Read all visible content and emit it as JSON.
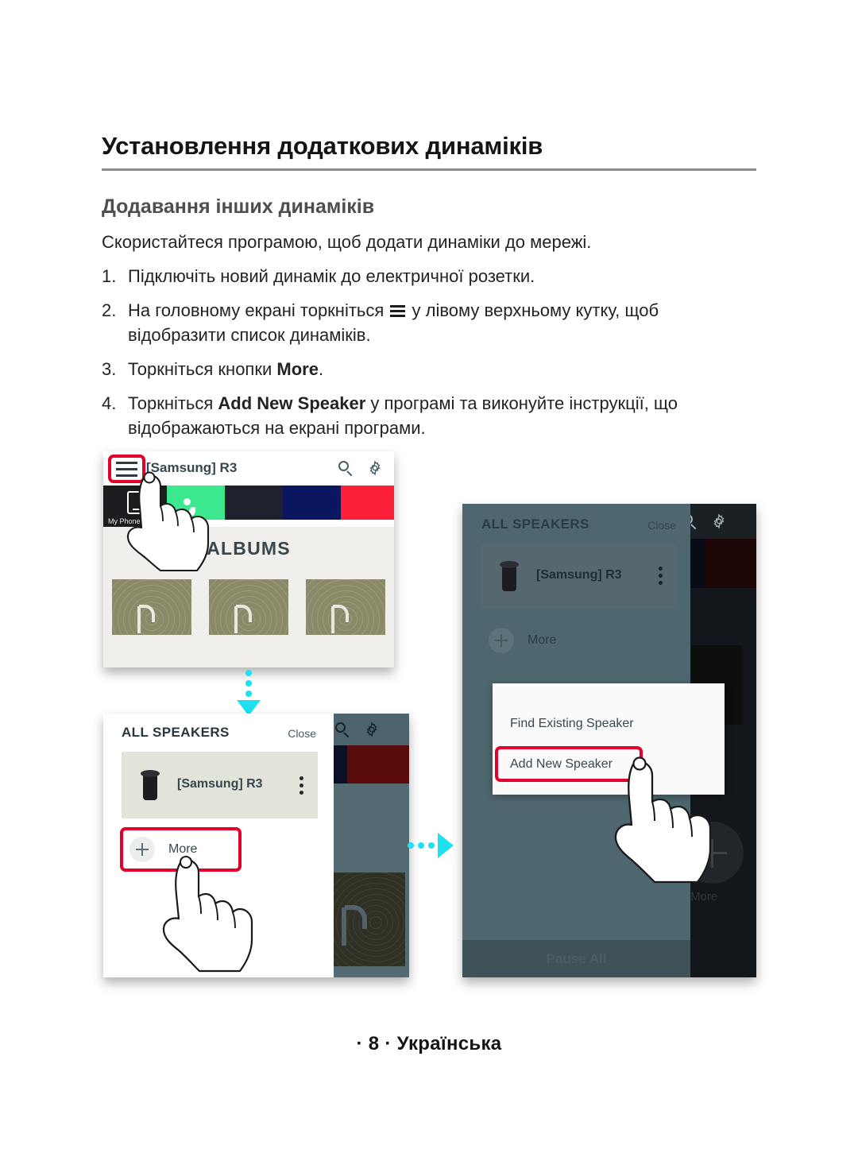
{
  "page": {
    "heading": "Установлення додаткових динаміків",
    "subheading": "Додавання інших динаміків",
    "intro": "Скористайтеся програмою, щоб додати динаміки до мережі.",
    "footer": "· 8 · Українська"
  },
  "steps": [
    {
      "num": "1.",
      "pre": "Підключіть новий динамік до електричної розетки.",
      "icon": "",
      "bold": "",
      "post": ""
    },
    {
      "num": "2.",
      "pre": "На головному екрані торкніться ",
      "icon": "hamburger-icon",
      "bold": "",
      "post": " у лівому верхньому кутку, щоб відобразити список динаміків."
    },
    {
      "num": "3.",
      "pre": "Торкніться кнопки ",
      "icon": "",
      "bold": "More",
      "post": "."
    },
    {
      "num": "4.",
      "pre": "Торкніться ",
      "icon": "",
      "bold": "Add New Speaker",
      "post": " у програмі та виконуйте інструкції, що відображаються на екрані програми."
    }
  ],
  "shot1": {
    "title": "[Samsung] R3",
    "my_phone_label": "My Phone",
    "albums_label": "ALBUMS",
    "search_icon": "search-icon",
    "settings_icon": "gear-icon",
    "menu_icon": "hamburger-icon",
    "strip_colors": [
      "#1b1c20",
      "#3ce88f",
      "#1e212b",
      "#0b1660",
      "#fb2038"
    ]
  },
  "shot2": {
    "header": "ALL SPEAKERS",
    "close_label": "Close",
    "speaker_name": "[Samsung] R3",
    "more_label": "More",
    "search_icon": "search-icon",
    "settings_icon": "gear-icon",
    "band_colors": [
      "#0b1024",
      "#0d1030",
      "#5a0c0c"
    ]
  },
  "shot3": {
    "header": "ALL SPEAKERS",
    "close_label": "Close",
    "speaker_name": "[Samsung] R3",
    "more_label": "More",
    "more_label_bg": "More",
    "pause_all_label": "Pause All",
    "dialog_option_1": "Find Existing Speaker",
    "dialog_option_2": "Add New Speaker",
    "search_icon": "search-icon",
    "settings_icon": "gear-icon",
    "band_colors": [
      "#090c17",
      "#0a0c1c",
      "#1d0707"
    ]
  },
  "colors": {
    "highlight": "#e4002b",
    "arrow": "#1ee0f0",
    "rule": "#8d8d8d"
  }
}
